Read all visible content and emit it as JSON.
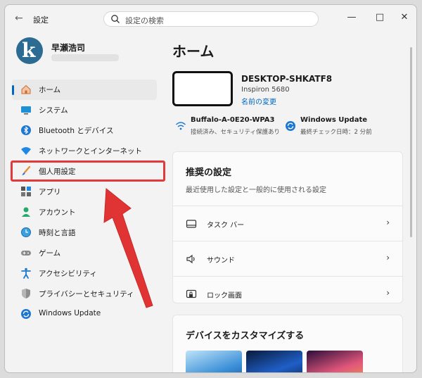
{
  "window": {
    "title": "設定",
    "search_placeholder": "設定の検索"
  },
  "profile": {
    "name": "早瀬浩司"
  },
  "nav": {
    "items": [
      {
        "label": "ホーム"
      },
      {
        "label": "システム"
      },
      {
        "label": "Bluetooth とデバイス"
      },
      {
        "label": "ネットワークとインターネット"
      },
      {
        "label": "個人用設定"
      },
      {
        "label": "アプリ"
      },
      {
        "label": "アカウント"
      },
      {
        "label": "時刻と言語"
      },
      {
        "label": "ゲーム"
      },
      {
        "label": "アクセシビリティ"
      },
      {
        "label": "プライバシーとセキュリティ"
      },
      {
        "label": "Windows Update"
      }
    ]
  },
  "main": {
    "title": "ホーム",
    "device": {
      "name": "DESKTOP-SHKATF8",
      "model": "Inspiron 5680",
      "rename_link": "名前の変更"
    },
    "network": {
      "title": "Buffalo-A-0E20-WPA3",
      "subtitle": "接続済み、セキュリティ保護あり"
    },
    "update": {
      "title": "Windows Update",
      "subtitle": "最終チェック日時：2 分前"
    },
    "recommended": {
      "heading": "推奨の設定",
      "description": "最近使用した設定と一般的に使用される設定",
      "rows": [
        {
          "label": "タスク バー"
        },
        {
          "label": "サウンド"
        },
        {
          "label": "ロック画面"
        }
      ]
    },
    "customize": {
      "heading": "デバイスをカスタマイズする"
    }
  },
  "colors": {
    "accent": "#0067c0",
    "highlight": "#e23a3a"
  }
}
